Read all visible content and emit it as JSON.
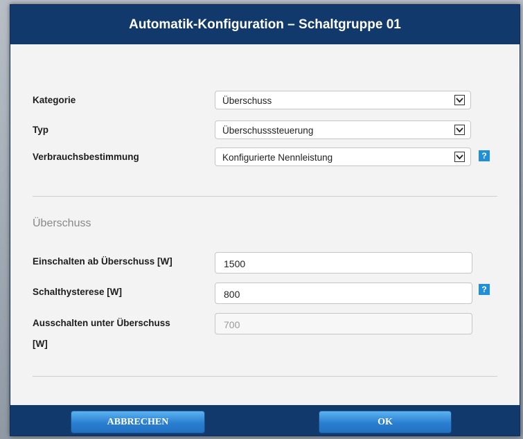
{
  "dialog": {
    "title": "Automatik-Konfiguration – Schaltgruppe 01"
  },
  "general": {
    "kategorie": {
      "label": "Kategorie",
      "value": "Überschuss"
    },
    "typ": {
      "label": "Typ",
      "value": "Überschusssteuerung"
    },
    "verbrauch": {
      "label": "Verbrauchsbestimmung",
      "value": "Konfigurierte Nennleistung",
      "help": "?"
    }
  },
  "section": {
    "title": "Überschuss"
  },
  "fields": {
    "einschalten": {
      "label": "Einschalten ab Überschuss [W]",
      "value": "1500"
    },
    "hysterese": {
      "label": "Schalthysterese [W]",
      "value": "800",
      "help": "?"
    },
    "ausschalten": {
      "label_line1": "Ausschalten unter Überschuss",
      "label_line2": "[W]",
      "value": "700"
    }
  },
  "footer": {
    "cancel_label": "ABBRECHEN",
    "ok_label": "OK"
  },
  "colors": {
    "titlebar": "#12396b",
    "help": "#1e8fd8"
  }
}
